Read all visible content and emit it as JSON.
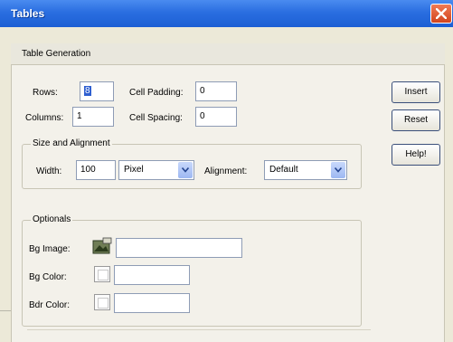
{
  "window": {
    "title": "Tables",
    "colors": {
      "titlebar": "#2a6ee0",
      "close": "#d2451e",
      "face": "#ece9d8"
    }
  },
  "group": {
    "title": "Table Generation"
  },
  "fields": {
    "rows": {
      "label": "Rows:",
      "value": "8"
    },
    "columns": {
      "label": "Columns:",
      "value": "1"
    },
    "cell_padding": {
      "label": "Cell Padding:",
      "value": "0"
    },
    "cell_spacing": {
      "label": "Cell Spacing:",
      "value": "0"
    }
  },
  "size_alignment": {
    "title": "Size and Alignment",
    "width_label": "Width:",
    "width_value": "100",
    "unit_selected": "Pixel",
    "alignment_label": "Alignment:",
    "alignment_selected": "Default"
  },
  "optionals": {
    "title": "Optionals",
    "bg_image_label": "Bg Image:",
    "bg_image_value": "",
    "bg_color_label": "Bg Color:",
    "bg_color_value": "",
    "bdr_color_label": "Bdr Color:",
    "bdr_color_value": ""
  },
  "buttons": {
    "insert": "Insert",
    "reset": "Reset",
    "help": "Help!"
  },
  "icons": {
    "close": "close-icon",
    "dropdown": "chevron-down-icon",
    "image_picker": "image-icon",
    "color_picker": "color-swatch-icon"
  }
}
